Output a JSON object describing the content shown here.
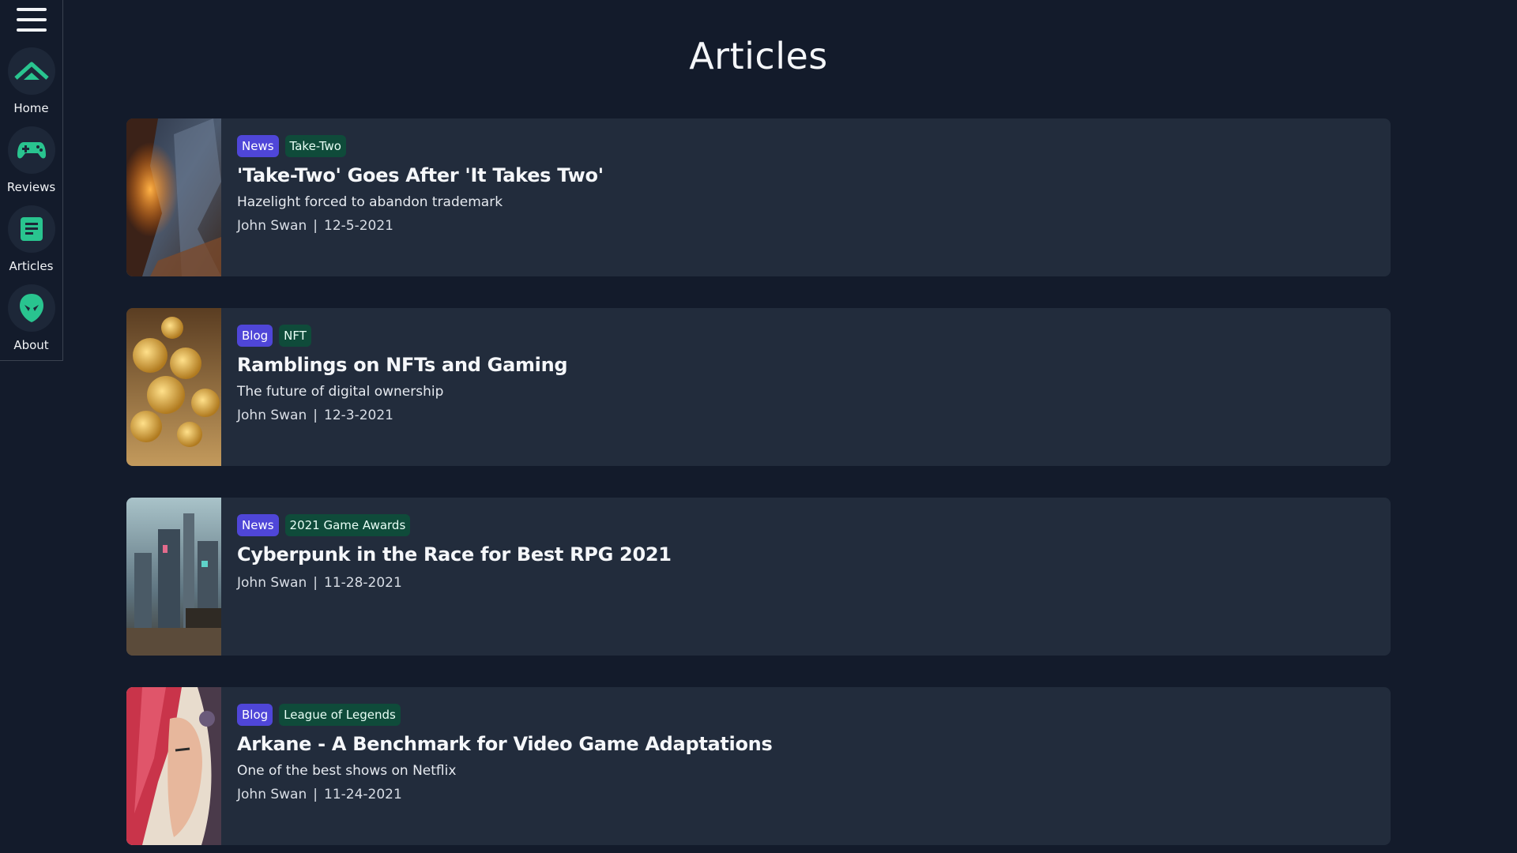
{
  "sidebar": {
    "menu_icon": "hamburger-menu-icon",
    "items": [
      {
        "label": "Home",
        "icon": "home-chevron-icon"
      },
      {
        "label": "Reviews",
        "icon": "gamepad-icon"
      },
      {
        "label": "Articles",
        "icon": "document-icon"
      },
      {
        "label": "About",
        "icon": "alien-head-icon"
      }
    ],
    "accent": "#29c48f"
  },
  "page": {
    "title": "Articles"
  },
  "articles": [
    {
      "type_tag": "News",
      "topic_tag": "Take-Two",
      "title": "'Take-Two' Goes After 'It Takes Two'",
      "subtitle": "Hazelight forced to abandon trademark",
      "author": "John Swan",
      "separator": "|",
      "date": "12-5-2021"
    },
    {
      "type_tag": "Blog",
      "topic_tag": "NFT",
      "title": "Ramblings on NFTs and Gaming",
      "subtitle": "The future of digital ownership",
      "author": "John Swan",
      "separator": "|",
      "date": "12-3-2021"
    },
    {
      "type_tag": "News",
      "topic_tag": "2021 Game Awards",
      "title": "Cyberpunk in the Race for Best RPG 2021",
      "subtitle": "",
      "author": "John Swan",
      "separator": "|",
      "date": "11-28-2021"
    },
    {
      "type_tag": "Blog",
      "topic_tag": "League of Legends",
      "title": "Arkane - A Benchmark for Video Game Adaptations",
      "subtitle": "One of the best shows on Netflix",
      "author": "John Swan",
      "separator": "|",
      "date": "11-24-2021"
    }
  ],
  "colors": {
    "background": "#131b2b",
    "card": "#222c3c",
    "type_tag": "#4f46d8",
    "topic_tag": "#0f4b3a"
  }
}
